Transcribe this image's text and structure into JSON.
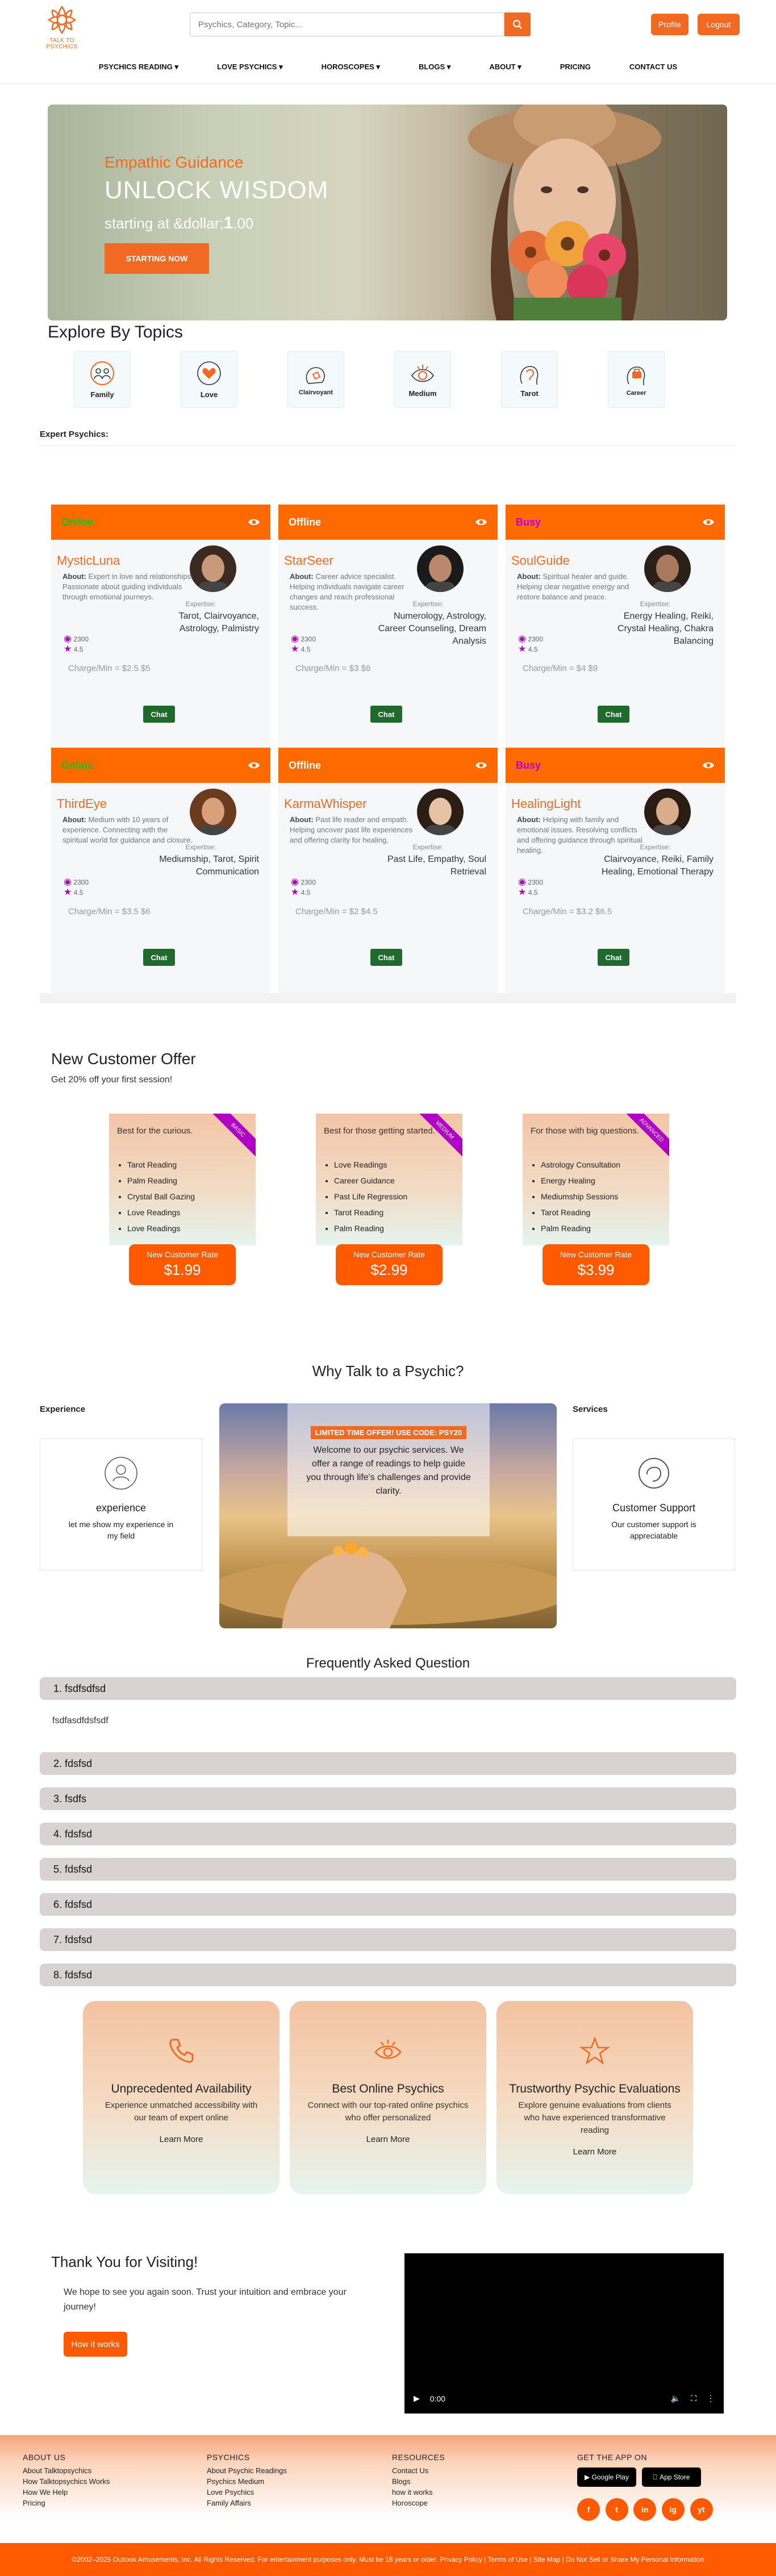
{
  "header": {
    "logo_text": "TALK TO PSYCHICS",
    "search_placeholder": "Psychics, Category, Topic...",
    "profile_label": "Profile",
    "logout_label": "Logout"
  },
  "nav": [
    "PSYCHICS READING ▾",
    "LOVE PSYCHICS ▾",
    "HOROSCOPES ▾",
    "BLOGS ▾",
    "ABOUT ▾",
    "PRICING",
    "CONTACT US"
  ],
  "hero": {
    "subtitle": "Empathic Guidance",
    "title": "UNLOCK WISDOM",
    "price_prefix": "starting at &dollar;",
    "price_value": "1",
    "price_suffix": ".00",
    "cta": "STARTING NOW"
  },
  "topics": {
    "title": "Explore By Topics",
    "items": [
      "Family",
      "Love",
      "Clairvoyant",
      "Medium",
      "Tarot",
      "Career"
    ]
  },
  "experts_label": "Expert Psychics:",
  "psychics": [
    {
      "status": "Online",
      "status_color": "#18c322",
      "name": "MysticLuna",
      "about": "Expert in love and relationships. Passionate about guiding individuals through emotional journeys.",
      "expertise": "Tarot, Clairvoyance, Astrology, Palmistry",
      "reviews": "2300",
      "rating": "4.5",
      "charge": "Charge/Min = $2.5 $5",
      "chat": "Chat"
    },
    {
      "status": "Offline",
      "status_color": "#ffffff",
      "name": "StarSeer",
      "about": "Career advice specialist. Helping individuals navigate career changes and reach professional success.",
      "expertise": "Numerology, Astrology, Career Counseling, Dream Analysis",
      "reviews": "2300",
      "rating": "4.5",
      "charge": "Charge/Min = $3 $6",
      "chat": "Chat"
    },
    {
      "status": "Busy",
      "status_color": "#b800d6",
      "name": "SoulGuide",
      "about": "Spiritual healer and guide. Helping clear negative energy and restore balance and peace.",
      "expertise": "Energy Healing, Reiki, Crystal Healing, Chakra Balancing",
      "reviews": "2300",
      "rating": "4.5",
      "charge": "Charge/Min = $4 $9",
      "chat": "Chat"
    },
    {
      "status": "Online",
      "status_color": "#18c322",
      "name": "ThirdEye",
      "about": "Medium with 10 years of experience. Connecting with the spiritual world for guidance and closure.",
      "expertise": "Mediumship, Tarot, Spirit Communication",
      "reviews": "2300",
      "rating": "4.5",
      "charge": "Charge/Min = $3.5 $6",
      "chat": "Chat"
    },
    {
      "status": "Offline",
      "status_color": "#ffffff",
      "name": "KarmaWhisper",
      "about": "Past life reader and empath. Helping uncover past life experiences and offering clarity for healing.",
      "expertise": "Past Life, Empathy, Soul Retrieval",
      "reviews": "2300",
      "rating": "4.5",
      "charge": "Charge/Min = $2 $4.5",
      "chat": "Chat"
    },
    {
      "status": "Busy",
      "status_color": "#b800d6",
      "name": "HealingLight",
      "about": "Helping with family and emotional issues. Resolving conflicts and offering guidance through spiritual healing.",
      "expertise": "Clairvoyance, Reiki, Family Healing, Emotional Therapy",
      "reviews": "2300",
      "rating": "4.5",
      "charge": "Charge/Min = $3.2 $6.5",
      "chat": "Chat"
    }
  ],
  "expertise_label": "Expertise:",
  "about_label": "About:",
  "offers": {
    "title": "New Customer Offer",
    "subtitle": "Get 20% off your first session!",
    "rate_label": "New Customer Rate",
    "cards": [
      {
        "heading": "Best for the curious.",
        "ribbon": "BASIC",
        "items": [
          "Tarot Reading",
          "Palm Reading",
          "Crystal Ball Gazing",
          "Love Readings",
          "Love Readings"
        ],
        "price": "$1.99"
      },
      {
        "heading": "Best for those getting started.",
        "ribbon": "MEDIUM",
        "items": [
          "Love Readings",
          "Career Guidance",
          "Past Life Regression",
          "Tarot Reading",
          "Palm Reading"
        ],
        "price": "$2.99"
      },
      {
        "heading": "For those with big questions.",
        "ribbon": "ADVANCED",
        "items": [
          "Astrology Consultation",
          "Energy Healing",
          "Mediumship Sessions",
          "Tarot Reading",
          "Palm Reading"
        ],
        "price": "$3.99"
      }
    ]
  },
  "why": {
    "title": "Why Talk to a Psychic?",
    "experience_label": "Experience",
    "services_label": "Services",
    "experience_title": "experience",
    "experience_text": "let me show my experience in my field",
    "services_title": "Customer Support",
    "services_text": "Our customer support is appreciatable",
    "promo_tag": "LIMITED TIME OFFER! USE CODE: PSY20",
    "promo_text": "Welcome to our psychic services. We offer a range of readings to help guide you through life's challenges and provide clarity."
  },
  "faq": {
    "title": "Frequently Asked Question",
    "items": [
      "1. fsdfsdfsd",
      "2. fdsfsd",
      "3. fsdfs",
      "4. fdsfsd",
      "5. fdsfsd",
      "6. fdsfsd",
      "7. fdsfsd",
      "8. fdsfsd"
    ],
    "open_answer": "fsdfasdfdsfsdf"
  },
  "features": [
    {
      "icon": "phone-icon",
      "title": "Unprecedented Availability",
      "text": "Experience unmatched accessibility with our team of expert online",
      "more": "Learn More"
    },
    {
      "icon": "eye-icon",
      "title": "Best Online Psychics",
      "text": "Connect with our top-rated online psychics who offer personalized",
      "more": "Learn More"
    },
    {
      "icon": "star-icon",
      "title": "Trustworthy Psychic Evaluations",
      "text": "Explore genuine evaluations from clients who have experienced transformative reading",
      "more": "Learn More"
    }
  ],
  "thankyou": {
    "title": "Thank You for Visiting!",
    "text": "We hope to see you again soon. Trust your intuition and embrace your journey!",
    "button": "How it works",
    "video_time": "0:00"
  },
  "footer": {
    "about": {
      "title": "ABOUT US",
      "links": [
        "About Talktopsychics",
        "How Talktopsychics Works",
        "How We Help",
        "Pricing"
      ]
    },
    "psychics": {
      "title": "PSYCHICS",
      "links": [
        "About Psychic Readings",
        "Psychics Medium",
        "Love Psychics",
        "Family Affairs"
      ]
    },
    "resources": {
      "title": "RESOURCES",
      "links": [
        "Contact Us",
        "Blogs",
        "how it works",
        "Horoscope"
      ]
    },
    "app": {
      "title": "GET THE APP ON",
      "google": "Google Play",
      "apple": "App Store"
    },
    "social": [
      "f",
      "t",
      "in",
      "ig",
      "yt"
    ],
    "copyright": "©2002–2025 Outlook Amusements, Inc. All Rights Reserved. For entertainment purposes only. Must be 18 years or older. Privacy Policy | Terms of Use | Site Map | Do Not Sell or Share My Personal Information"
  },
  "colors": {
    "accent": "#f26a21",
    "card_header": "#ff6a00",
    "chat": "#1f6b2e"
  }
}
